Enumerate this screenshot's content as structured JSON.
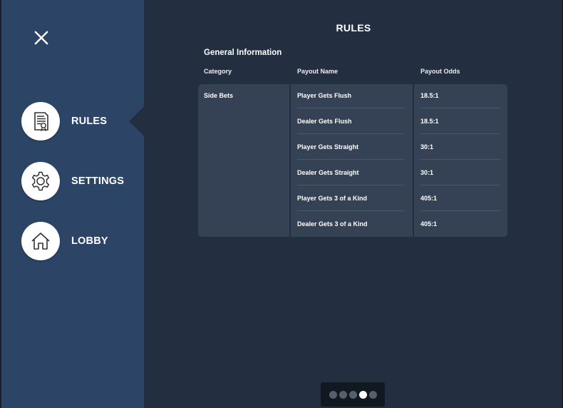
{
  "sidebar": {
    "menu": [
      {
        "label": "RULES",
        "icon": "rules-document-icon",
        "active": true
      },
      {
        "label": "SETTINGS",
        "icon": "gear-icon",
        "active": false
      },
      {
        "label": "LOBBY",
        "icon": "home-icon",
        "active": false
      }
    ]
  },
  "page": {
    "title": "RULES"
  },
  "rules": {
    "section_title": "General Information",
    "headers": {
      "category": "Category",
      "payout_name": "Payout Name",
      "payout_odds": "Payout Odds"
    },
    "category": "Side Bets",
    "rows": [
      {
        "name": "Player Gets Flush",
        "odds": "18.5:1"
      },
      {
        "name": "Dealer Gets Flush",
        "odds": "18.5:1"
      },
      {
        "name": "Player Gets Straight",
        "odds": "30:1"
      },
      {
        "name": "Dealer Gets Straight",
        "odds": "30:1"
      },
      {
        "name": "Player Gets 3 of a Kind",
        "odds": "405:1"
      },
      {
        "name": "Dealer Gets 3 of a Kind",
        "odds": "405:1"
      }
    ]
  },
  "pager": {
    "count": 5,
    "active_index": 3
  },
  "colors": {
    "background": "#232f40",
    "sidebar": "#2c4566",
    "table": "#354255",
    "pager": "#101820",
    "dot_inactive": "#56606b",
    "dot_active": "#ffffff"
  }
}
